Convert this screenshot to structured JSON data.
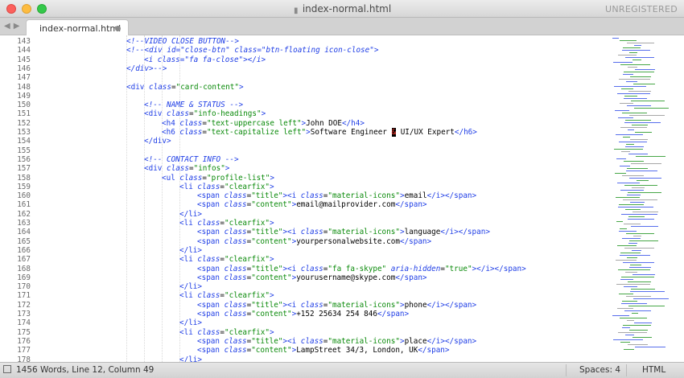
{
  "window": {
    "title": "index-normal.html",
    "license_badge": "UNREGISTERED"
  },
  "tabs": [
    {
      "label": "index-normal.html",
      "dirty": true
    }
  ],
  "status": {
    "stats": "1456 Words, Line 12, Column 49",
    "indent": "Spaces: 4",
    "syntax": "HTML"
  },
  "colors": {
    "tag": "#1f3ee6",
    "attr_value": "#0a8a0a",
    "line_number": "#6a6a6a"
  },
  "code_lines": [
    {
      "n": "143",
      "indent": 0,
      "tokens": [
        {
          "t": "<!--VIDEO CLOSE BUTTON-->",
          "k": "comment"
        }
      ]
    },
    {
      "n": "144",
      "indent": 0,
      "tokens": [
        {
          "t": "<!--<div id=\"close-btn\" class=\"btn-floating icon-close\">",
          "k": "comment"
        }
      ]
    },
    {
      "n": "145",
      "indent": 1,
      "tokens": [
        {
          "t": "<i class=\"fa fa-close\"></i>",
          "k": "comment"
        }
      ]
    },
    {
      "n": "146",
      "indent": 0,
      "tokens": [
        {
          "t": "</div>-->",
          "k": "comment"
        }
      ]
    },
    {
      "n": "147",
      "indent": 0,
      "tokens": []
    },
    {
      "n": "148",
      "indent": 0,
      "tokens": [
        {
          "t": "<div ",
          "k": "tag"
        },
        {
          "t": "class",
          "k": "attr"
        },
        {
          "t": "=",
          "k": "eq"
        },
        {
          "t": "\"card-content\"",
          "k": "val"
        },
        {
          "t": ">",
          "k": "tag"
        }
      ]
    },
    {
      "n": "149",
      "indent": 0,
      "tokens": []
    },
    {
      "n": "150",
      "indent": 1,
      "tokens": [
        {
          "t": "<!-- NAME & STATUS -->",
          "k": "comment"
        }
      ]
    },
    {
      "n": "151",
      "indent": 1,
      "tokens": [
        {
          "t": "<div ",
          "k": "tag"
        },
        {
          "t": "class",
          "k": "attr"
        },
        {
          "t": "=",
          "k": "eq"
        },
        {
          "t": "\"info-headings\"",
          "k": "val"
        },
        {
          "t": ">",
          "k": "tag"
        }
      ]
    },
    {
      "n": "152",
      "indent": 2,
      "tokens": [
        {
          "t": "<h4 ",
          "k": "tag"
        },
        {
          "t": "class",
          "k": "attr"
        },
        {
          "t": "=",
          "k": "eq"
        },
        {
          "t": "\"text-uppercase left\"",
          "k": "val"
        },
        {
          "t": ">",
          "k": "tag"
        },
        {
          "t": "John DOE",
          "k": "text"
        },
        {
          "t": "</h4>",
          "k": "tag"
        }
      ]
    },
    {
      "n": "153",
      "indent": 2,
      "tokens": [
        {
          "t": "<h6 ",
          "k": "tag"
        },
        {
          "t": "class",
          "k": "attr"
        },
        {
          "t": "=",
          "k": "eq"
        },
        {
          "t": "\"text-capitalize left\"",
          "k": "val"
        },
        {
          "t": ">",
          "k": "tag"
        },
        {
          "t": "Software Engineer ",
          "k": "text"
        },
        {
          "t": "&",
          "k": "ent"
        },
        {
          "t": " UI/UX Expert",
          "k": "text"
        },
        {
          "t": "</h6>",
          "k": "tag"
        }
      ]
    },
    {
      "n": "154",
      "indent": 1,
      "tokens": [
        {
          "t": "</div>",
          "k": "tag"
        }
      ]
    },
    {
      "n": "155",
      "indent": 0,
      "tokens": []
    },
    {
      "n": "156",
      "indent": 1,
      "tokens": [
        {
          "t": "<!-- CONTACT INFO -->",
          "k": "comment"
        }
      ]
    },
    {
      "n": "157",
      "indent": 1,
      "tokens": [
        {
          "t": "<div ",
          "k": "tag"
        },
        {
          "t": "class",
          "k": "attr"
        },
        {
          "t": "=",
          "k": "eq"
        },
        {
          "t": "\"infos\"",
          "k": "val"
        },
        {
          "t": ">",
          "k": "tag"
        }
      ]
    },
    {
      "n": "158",
      "indent": 2,
      "tokens": [
        {
          "t": "<ul ",
          "k": "tag"
        },
        {
          "t": "class",
          "k": "attr"
        },
        {
          "t": "=",
          "k": "eq"
        },
        {
          "t": "\"profile-list\"",
          "k": "val"
        },
        {
          "t": ">",
          "k": "tag"
        }
      ]
    },
    {
      "n": "159",
      "indent": 3,
      "tokens": [
        {
          "t": "<li ",
          "k": "tag"
        },
        {
          "t": "class",
          "k": "attr"
        },
        {
          "t": "=",
          "k": "eq"
        },
        {
          "t": "\"clearfix\"",
          "k": "val"
        },
        {
          "t": ">",
          "k": "tag"
        }
      ]
    },
    {
      "n": "160",
      "indent": 4,
      "tokens": [
        {
          "t": "<span ",
          "k": "tag"
        },
        {
          "t": "class",
          "k": "attr"
        },
        {
          "t": "=",
          "k": "eq"
        },
        {
          "t": "\"title\"",
          "k": "val"
        },
        {
          "t": "><i ",
          "k": "tag"
        },
        {
          "t": "class",
          "k": "attr"
        },
        {
          "t": "=",
          "k": "eq"
        },
        {
          "t": "\"material-icons\"",
          "k": "val"
        },
        {
          "t": ">",
          "k": "tag"
        },
        {
          "t": "email",
          "k": "text"
        },
        {
          "t": "</i></span>",
          "k": "tag"
        }
      ]
    },
    {
      "n": "161",
      "indent": 4,
      "tokens": [
        {
          "t": "<span ",
          "k": "tag"
        },
        {
          "t": "class",
          "k": "attr"
        },
        {
          "t": "=",
          "k": "eq"
        },
        {
          "t": "\"content\"",
          "k": "val"
        },
        {
          "t": ">",
          "k": "tag"
        },
        {
          "t": "email@mailprovider.com",
          "k": "text"
        },
        {
          "t": "</span>",
          "k": "tag"
        }
      ]
    },
    {
      "n": "162",
      "indent": 3,
      "tokens": [
        {
          "t": "</li>",
          "k": "tag"
        }
      ]
    },
    {
      "n": "163",
      "indent": 3,
      "tokens": [
        {
          "t": "<li ",
          "k": "tag"
        },
        {
          "t": "class",
          "k": "attr"
        },
        {
          "t": "=",
          "k": "eq"
        },
        {
          "t": "\"clearfix\"",
          "k": "val"
        },
        {
          "t": ">",
          "k": "tag"
        }
      ]
    },
    {
      "n": "164",
      "indent": 4,
      "tokens": [
        {
          "t": "<span ",
          "k": "tag"
        },
        {
          "t": "class",
          "k": "attr"
        },
        {
          "t": "=",
          "k": "eq"
        },
        {
          "t": "\"title\"",
          "k": "val"
        },
        {
          "t": "><i ",
          "k": "tag"
        },
        {
          "t": "class",
          "k": "attr"
        },
        {
          "t": "=",
          "k": "eq"
        },
        {
          "t": "\"material-icons\"",
          "k": "val"
        },
        {
          "t": ">",
          "k": "tag"
        },
        {
          "t": "language",
          "k": "text"
        },
        {
          "t": "</i></span>",
          "k": "tag"
        }
      ]
    },
    {
      "n": "165",
      "indent": 4,
      "tokens": [
        {
          "t": "<span ",
          "k": "tag"
        },
        {
          "t": "class",
          "k": "attr"
        },
        {
          "t": "=",
          "k": "eq"
        },
        {
          "t": "\"content\"",
          "k": "val"
        },
        {
          "t": ">",
          "k": "tag"
        },
        {
          "t": "yourpersonalwebsite.com",
          "k": "text"
        },
        {
          "t": "</span>",
          "k": "tag"
        }
      ]
    },
    {
      "n": "166",
      "indent": 3,
      "tokens": [
        {
          "t": "</li>",
          "k": "tag"
        }
      ]
    },
    {
      "n": "167",
      "indent": 3,
      "tokens": [
        {
          "t": "<li ",
          "k": "tag"
        },
        {
          "t": "class",
          "k": "attr"
        },
        {
          "t": "=",
          "k": "eq"
        },
        {
          "t": "\"clearfix\"",
          "k": "val"
        },
        {
          "t": ">",
          "k": "tag"
        }
      ]
    },
    {
      "n": "168",
      "indent": 4,
      "tokens": [
        {
          "t": "<span ",
          "k": "tag"
        },
        {
          "t": "class",
          "k": "attr"
        },
        {
          "t": "=",
          "k": "eq"
        },
        {
          "t": "\"title\"",
          "k": "val"
        },
        {
          "t": "><i ",
          "k": "tag"
        },
        {
          "t": "class",
          "k": "attr"
        },
        {
          "t": "=",
          "k": "eq"
        },
        {
          "t": "\"fa fa-skype\"",
          "k": "val"
        },
        {
          "t": " ",
          "k": "text"
        },
        {
          "t": "aria-hidden",
          "k": "attr"
        },
        {
          "t": "=",
          "k": "eq"
        },
        {
          "t": "\"true\"",
          "k": "val"
        },
        {
          "t": "></i></span>",
          "k": "tag"
        }
      ]
    },
    {
      "n": "169",
      "indent": 4,
      "tokens": [
        {
          "t": "<span ",
          "k": "tag"
        },
        {
          "t": "class",
          "k": "attr"
        },
        {
          "t": "=",
          "k": "eq"
        },
        {
          "t": "\"content\"",
          "k": "val"
        },
        {
          "t": ">",
          "k": "tag"
        },
        {
          "t": "yourusername@skype.com",
          "k": "text"
        },
        {
          "t": "</span>",
          "k": "tag"
        }
      ]
    },
    {
      "n": "170",
      "indent": 3,
      "tokens": [
        {
          "t": "</li>",
          "k": "tag"
        }
      ]
    },
    {
      "n": "171",
      "indent": 3,
      "tokens": [
        {
          "t": "<li ",
          "k": "tag"
        },
        {
          "t": "class",
          "k": "attr"
        },
        {
          "t": "=",
          "k": "eq"
        },
        {
          "t": "\"clearfix\"",
          "k": "val"
        },
        {
          "t": ">",
          "k": "tag"
        }
      ]
    },
    {
      "n": "172",
      "indent": 4,
      "tokens": [
        {
          "t": "<span ",
          "k": "tag"
        },
        {
          "t": "class",
          "k": "attr"
        },
        {
          "t": "=",
          "k": "eq"
        },
        {
          "t": "\"title\"",
          "k": "val"
        },
        {
          "t": "><i ",
          "k": "tag"
        },
        {
          "t": "class",
          "k": "attr"
        },
        {
          "t": "=",
          "k": "eq"
        },
        {
          "t": "\"material-icons\"",
          "k": "val"
        },
        {
          "t": ">",
          "k": "tag"
        },
        {
          "t": "phone",
          "k": "text"
        },
        {
          "t": "</i></span>",
          "k": "tag"
        }
      ]
    },
    {
      "n": "173",
      "indent": 4,
      "tokens": [
        {
          "t": "<span ",
          "k": "tag"
        },
        {
          "t": "class",
          "k": "attr"
        },
        {
          "t": "=",
          "k": "eq"
        },
        {
          "t": "\"content\"",
          "k": "val"
        },
        {
          "t": ">",
          "k": "tag"
        },
        {
          "t": "+152 25634 254 846",
          "k": "text"
        },
        {
          "t": "</span>",
          "k": "tag"
        }
      ]
    },
    {
      "n": "174",
      "indent": 3,
      "tokens": [
        {
          "t": "</li>",
          "k": "tag"
        }
      ]
    },
    {
      "n": "175",
      "indent": 3,
      "tokens": [
        {
          "t": "<li ",
          "k": "tag"
        },
        {
          "t": "class",
          "k": "attr"
        },
        {
          "t": "=",
          "k": "eq"
        },
        {
          "t": "\"clearfix\"",
          "k": "val"
        },
        {
          "t": ">",
          "k": "tag"
        }
      ]
    },
    {
      "n": "176",
      "indent": 4,
      "tokens": [
        {
          "t": "<span ",
          "k": "tag"
        },
        {
          "t": "class",
          "k": "attr"
        },
        {
          "t": "=",
          "k": "eq"
        },
        {
          "t": "\"title\"",
          "k": "val"
        },
        {
          "t": "><i ",
          "k": "tag"
        },
        {
          "t": "class",
          "k": "attr"
        },
        {
          "t": "=",
          "k": "eq"
        },
        {
          "t": "\"material-icons\"",
          "k": "val"
        },
        {
          "t": ">",
          "k": "tag"
        },
        {
          "t": "place",
          "k": "text"
        },
        {
          "t": "</i></span>",
          "k": "tag"
        }
      ]
    },
    {
      "n": "177",
      "indent": 4,
      "tokens": [
        {
          "t": "<span ",
          "k": "tag"
        },
        {
          "t": "class",
          "k": "attr"
        },
        {
          "t": "=",
          "k": "eq"
        },
        {
          "t": "\"content\"",
          "k": "val"
        },
        {
          "t": ">",
          "k": "tag"
        },
        {
          "t": "LampStreet 34/3, London, UK",
          "k": "text"
        },
        {
          "t": "</span>",
          "k": "tag"
        }
      ]
    },
    {
      "n": "178",
      "indent": 3,
      "tokens": [
        {
          "t": "</li>",
          "k": "tag"
        }
      ]
    }
  ]
}
